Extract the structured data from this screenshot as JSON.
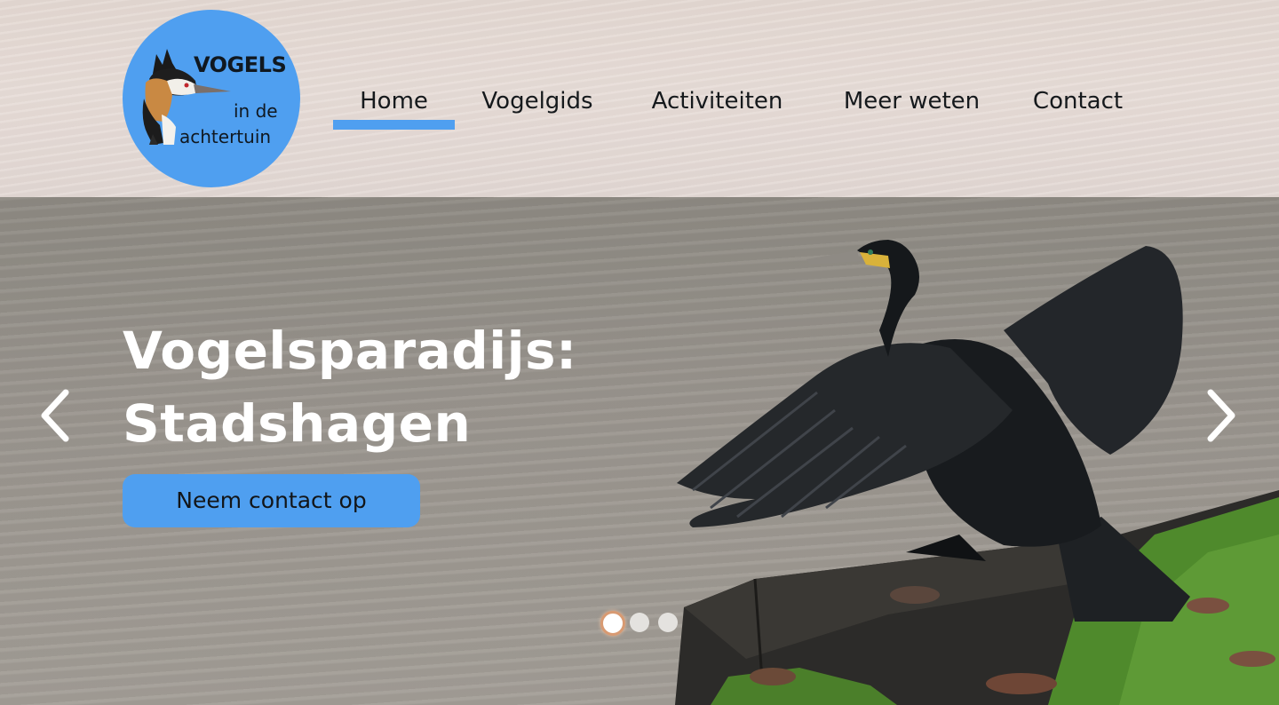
{
  "logo": {
    "line1": "VOGELS",
    "line2": "in de",
    "line3": "achtertuin"
  },
  "nav": {
    "items": [
      {
        "label": "Home",
        "active": true
      },
      {
        "label": "Vogelgids",
        "active": false
      },
      {
        "label": "Activiteiten",
        "active": false
      },
      {
        "label": "Meer weten",
        "active": false
      },
      {
        "label": "Contact",
        "active": false
      }
    ]
  },
  "hero": {
    "title_line1": "Vogelsparadijs:",
    "title_line2": "Stadshagen",
    "cta_label": "Neem contact op",
    "prev_icon": "chevron-left-icon",
    "next_icon": "chevron-right-icon",
    "slides_count": 3,
    "active_slide": 1
  },
  "colors": {
    "accent": "#4f9ff0",
    "text_dark": "#15191c",
    "text_light": "#ffffff"
  }
}
